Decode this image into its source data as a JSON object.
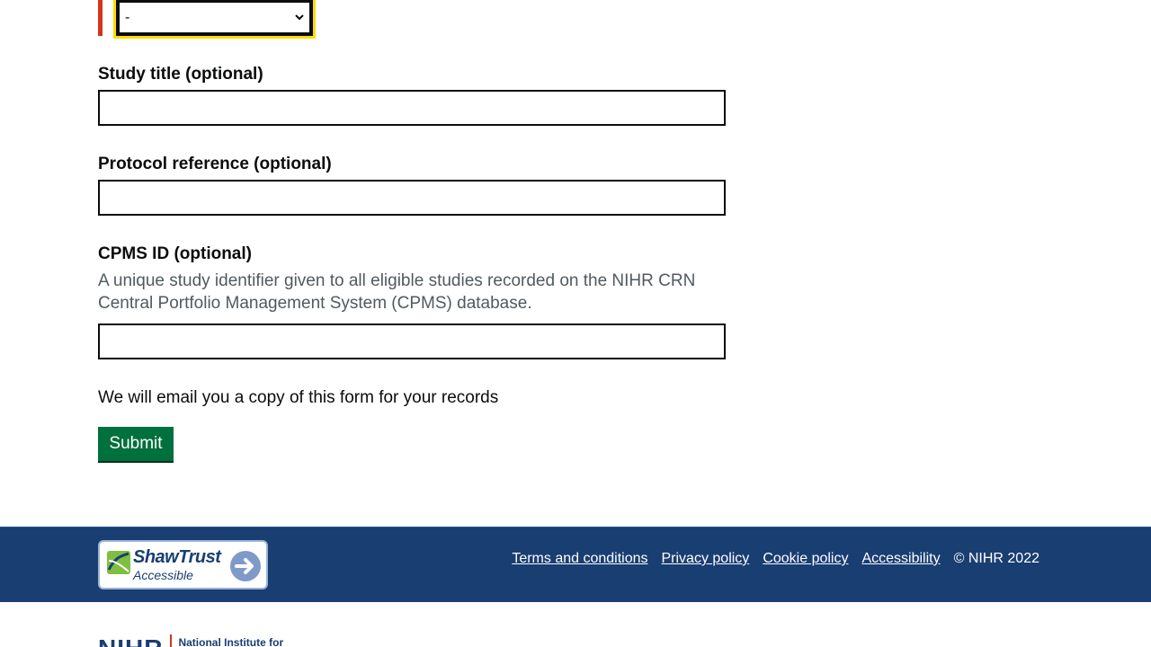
{
  "form": {
    "select_value": "-",
    "study_title_label": "Study title (optional)",
    "study_title_value": "",
    "protocol_label": "Protocol reference (optional)",
    "protocol_value": "",
    "cpms_label": "CPMS ID (optional)",
    "cpms_hint": "A unique study identifier given to all eligible studies recorded on the NIHR CRN Central Portfolio Management System (CPMS) database.",
    "cpms_value": "",
    "email_note": "We will email you a copy of this form for your records",
    "submit_label": "Submit"
  },
  "footer": {
    "badge_name": "ShawTrust",
    "badge_sub": "Accessible",
    "links": [
      "Terms and conditions",
      "Privacy policy",
      "Cookie policy",
      "Accessibility"
    ],
    "copyright": "© NIHR 2022"
  },
  "logo": {
    "letters": "NIHR",
    "text": "National Institute for"
  },
  "colors": {
    "footer_bg": "#193e72",
    "submit_bg": "#00703c",
    "error_bar": "#d4351c",
    "focus": "#ffdd00"
  }
}
